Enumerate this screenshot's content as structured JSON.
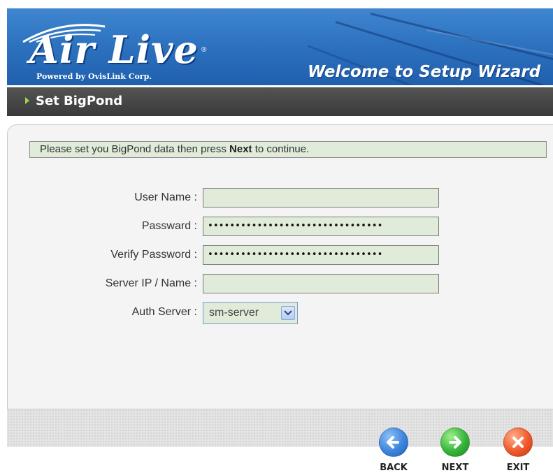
{
  "header": {
    "brand": "Air Live",
    "brand_reg": "®",
    "tagline": "Powered by OvisLink Corp.",
    "wizard_title": "Welcome to Setup Wizard"
  },
  "section": {
    "title": "Set BigPond"
  },
  "instructions": {
    "prefix": "Please set you BigPond data then press ",
    "emphasis": "Next",
    "suffix": " to continue."
  },
  "form": {
    "user_name": {
      "label": "User Name :",
      "value": ""
    },
    "password": {
      "label": "Passward :",
      "value": "••••••••••••••••••••••••••••••••"
    },
    "verify_password": {
      "label": "Verify Password :",
      "value": "••••••••••••••••••••••••••••••••"
    },
    "server": {
      "label": "Server IP / Name :",
      "value": ""
    },
    "auth_server": {
      "label": "Auth Server :",
      "selected": "sm-server"
    }
  },
  "nav": {
    "back_label": "BACK",
    "next_label": "NEXT",
    "exit_label": "EXIT"
  },
  "colors": {
    "header_blue": "#2e73c0",
    "section_bar": "#474747",
    "field_bg": "#e0ebd9",
    "back": "#3c85dc",
    "next": "#35b53a",
    "exit": "#f0582a"
  },
  "icons": {
    "section": "triangle-right-icon",
    "select": "chevron-down-icon",
    "back": "arrow-left-icon",
    "next": "arrow-right-icon",
    "exit": "close-icon"
  }
}
